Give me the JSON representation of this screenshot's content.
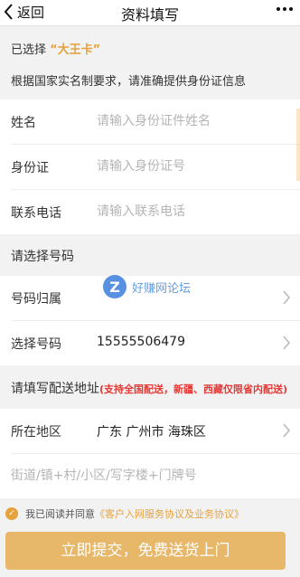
{
  "nav": {
    "back_label": "返回",
    "title": "资料填写"
  },
  "selected": {
    "prefix": "已选择 ",
    "card_name": "“大王卡”"
  },
  "notice": "根据国家实名制要求，请准确提供身份证信息",
  "identity": {
    "name": {
      "label": "姓名",
      "placeholder": "请输入身份证件姓名"
    },
    "id_card": {
      "label": "身份证",
      "placeholder": "请输入身份证号"
    },
    "phone": {
      "label": "联系电话",
      "placeholder": "请输入联系电话"
    }
  },
  "number_section": {
    "title": "请选择号码",
    "attribution": {
      "label": "号码归属",
      "value": ""
    },
    "number": {
      "label": "选择号码",
      "value": "15555506479"
    }
  },
  "address_section": {
    "title": "请填写配送地址",
    "note": "(支持全国配送，新疆、西藏仅限省内配送)",
    "region": {
      "label": "所在地区",
      "value": "广东  广州市  海珠区"
    },
    "street": {
      "placeholder": "街道/镇+村/小区/写字楼+门牌号"
    }
  },
  "agreement": {
    "prefix": "我已阅读并同意",
    "link": "《客户入网服务协议及业务协议》"
  },
  "submit_label": "立即提交，免费送货上门",
  "watermark": {
    "logo": "Z",
    "text": "好赚网论坛"
  },
  "colors": {
    "accent": "#e6a23c",
    "button": "#e8b86a",
    "note_red": "#e53935"
  }
}
